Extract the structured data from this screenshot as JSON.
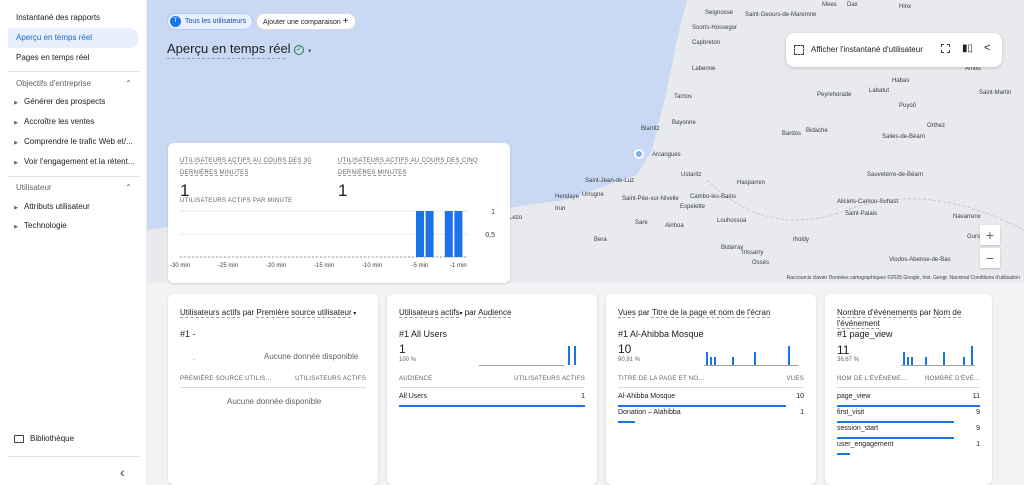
{
  "sidebar": {
    "items": [
      {
        "label": "Instantané des rapports"
      },
      {
        "label": "Aperçu en temps réel"
      },
      {
        "label": "Pages en temps réel"
      }
    ],
    "sections": [
      {
        "label": "Objectifs d'entreprise",
        "sub": [
          "Générer des prospects",
          "Accroître les ventes",
          "Comprendre le trafic Web et/...",
          "Voir l'engagement et la rétent..."
        ]
      },
      {
        "label": "Utilisateur",
        "sub": [
          "Attributs utilisateur",
          "Technologie"
        ]
      }
    ],
    "library": "Bibliothèque",
    "collapse": "‹"
  },
  "header": {
    "chip_all": "Tous les utilisateurs",
    "chip_all_letter": "T",
    "chip_compare": "Ajouter une comparaison",
    "title": "Aperçu en temps réel"
  },
  "map_toolbar": {
    "snapshot": "Afficher l'instantané d'utilisateur"
  },
  "map": {
    "labels": [
      "Mees",
      "Dax",
      "Hinx",
      "Seignosse",
      "Saint-Geours-de-Maremne",
      "Soorts-Hossegor",
      "Capbreton",
      "Amou",
      "Labenne",
      "Habas",
      "Labatut",
      "Saint-Martin",
      "Peyrehorade",
      "Tarnos",
      "Puyoô",
      "Bayonne",
      "Biarritz",
      "Bidache",
      "Bardos",
      "Orthez",
      "Salies-de-Béarn",
      "Arcangues",
      "Ustaritz",
      "Sauveterre-de-Béarn",
      "Hasparren",
      "Saint-Jean-de-Luz",
      "Urrugne",
      "Saint-Pée-sur-Nivelle",
      "Cambo-les-Bains",
      "Hendaye",
      "Espelette",
      "Aliciets-Camou-Suhast",
      "Irun",
      "Saint-Palais",
      "Navarrenx",
      "Sare",
      "Louhossoa",
      "Ainhoa",
      "Lezo",
      "Bera",
      "Bidarray",
      "Iholdy",
      "Gurs",
      "Irissarry",
      "Viodos-Abense-de-Bas",
      "Ossès"
    ],
    "attribution": "Raccourcis clavier   Données cartographiques ©2025 Google, Inst. Geogr. Nacional   Conditions d'utilisation"
  },
  "realtime": {
    "kpi1_label": "UTILISATEURS ACTIFS AU COURS DES 30 DERNIÈRES MINUTES",
    "kpi1_value": "1",
    "kpi2_label": "UTILISATEURS ACTIFS AU COURS DES CINQ DERNIÈRES MINUTES",
    "kpi2_value": "1",
    "per_minute_label": "UTILISATEURS ACTIFS PAR MINUTE",
    "ticks_x": [
      "-30 min",
      "-25 min",
      "-20 min",
      "-15 min",
      "-10 min",
      "-5 min",
      "-1 min"
    ],
    "ticks_y": [
      "1",
      "0,5"
    ]
  },
  "chart_data": {
    "type": "bar",
    "title": "UTILISATEURS ACTIFS PAR MINUTE",
    "x": [
      "-5",
      "-4",
      "-3",
      "-2",
      "-1"
    ],
    "values": [
      1,
      1,
      0,
      1,
      1
    ],
    "ylim": [
      0,
      1
    ]
  },
  "cards": [
    {
      "title_a": "Utilisateurs actifs",
      "title_b": " par ",
      "title_c": "Première source utilisateur",
      "top": "#1 -",
      "empty1": "Aucune donnée disponible",
      "col1": "PREMIÈRE SOURCE UTILIS...",
      "col2": "UTILISATEURS ACTIFS",
      "empty2": "Aucune donnée disponible"
    },
    {
      "title_a": "Utilisateurs actifs",
      "title_b": " par ",
      "title_c": "Audience",
      "top": "#1  All Users",
      "big": "1",
      "pct": "100 %",
      "col1": "AUDIENCE",
      "col2": "UTILISATEURS ACTIFS",
      "rows": [
        {
          "label": "All Users",
          "value": "1"
        }
      ]
    },
    {
      "title_a": "Vues",
      "title_b": " par ",
      "title_c": "Titre de la page et nom de l'écran",
      "top": "#1  Al-Ahibba Mosque",
      "big": "10",
      "pct": "90,91 %",
      "col1": "TITRE DE LA PAGE ET NO...",
      "col2": "VUES",
      "rows": [
        {
          "label": "Al-Ahibba Mosque",
          "value": "10"
        },
        {
          "label": "Donation – Alahibba",
          "value": "1"
        }
      ]
    },
    {
      "title_a": "Nombre d'événements",
      "title_b": " par ",
      "title_c": "Nom de l'événement",
      "top": "#1  page_view",
      "big": "11",
      "pct": "36,67 %",
      "col1": "NOM DE L'ÉVÉNEME...",
      "col2": "NOMBRE D'ÉVÉ...",
      "rows": [
        {
          "label": "page_view",
          "value": "11"
        },
        {
          "label": "first_visit",
          "value": "9"
        },
        {
          "label": "session_start",
          "value": "9"
        },
        {
          "label": "user_engagement",
          "value": "1"
        }
      ]
    }
  ]
}
